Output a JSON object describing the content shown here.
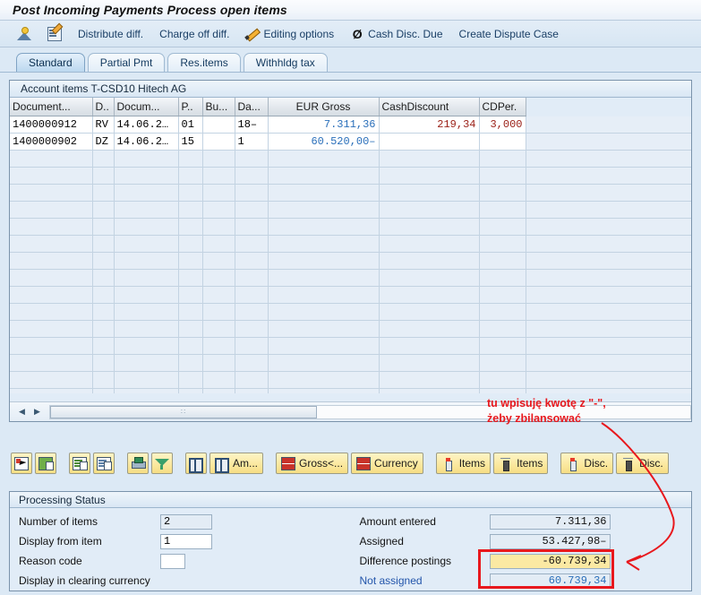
{
  "window": {
    "title": "Post Incoming Payments  Process open items"
  },
  "function_toolbar": {
    "items": [
      {
        "label": "",
        "icon": "distribute-person-icon",
        "interactable": true
      },
      {
        "label": "",
        "icon": "note-edit-icon",
        "interactable": true
      },
      {
        "label": "Distribute diff.",
        "icon": "",
        "interactable": true
      },
      {
        "label": "Charge off diff.",
        "icon": "",
        "interactable": true
      },
      {
        "label": "Editing options",
        "icon": "pencil-icon",
        "interactable": true
      },
      {
        "label": "Cash Disc. Due",
        "icon": "slashed-zero-icon",
        "interactable": true
      },
      {
        "label": "Create Dispute Case",
        "icon": "",
        "interactable": true
      }
    ]
  },
  "tabs": [
    {
      "label": "Standard",
      "active": true
    },
    {
      "label": "Partial Pmt",
      "active": false
    },
    {
      "label": "Res.items",
      "active": false
    },
    {
      "label": "Withhldg tax",
      "active": false
    }
  ],
  "grid": {
    "caption": "Account items T-CSD10 Hitech AG",
    "columns": [
      {
        "key": "document",
        "label": "Document...",
        "align": "left"
      },
      {
        "key": "doctype",
        "label": "D..",
        "align": "left"
      },
      {
        "key": "docdate",
        "label": "Docum...",
        "align": "left"
      },
      {
        "key": "p",
        "label": "P..",
        "align": "left"
      },
      {
        "key": "bu",
        "label": "Bu...",
        "align": "left"
      },
      {
        "key": "da",
        "label": "Da...",
        "align": "left"
      },
      {
        "key": "eurgross",
        "label": "EUR Gross",
        "align": "center"
      },
      {
        "key": "cashdiscount",
        "label": "CashDiscount",
        "align": "left"
      },
      {
        "key": "cdper",
        "label": "CDPer.",
        "align": "left"
      }
    ],
    "rows": [
      {
        "document": "1400000912",
        "doctype": "RV",
        "docdate": "14.06.2…",
        "p": "01",
        "bu": "",
        "da": "18–",
        "eurgross": "7.311,36",
        "eurgross_color": "blue",
        "cashdiscount": "219,34",
        "cashdiscount_color": "red",
        "cdper": "3,000",
        "cdper_color": "red"
      },
      {
        "document": "1400000902",
        "doctype": "DZ",
        "docdate": "14.06.2…",
        "p": "15",
        "bu": "",
        "da": "1",
        "eurgross": "60.520,00–",
        "eurgross_color": "blue",
        "cashdiscount": "",
        "cashdiscount_color": "black",
        "cdper": "",
        "cdper_color": "black"
      }
    ],
    "empty_row_count": 15,
    "scrollbar": {
      "left_arrow": "◀",
      "right_arrow": "▶",
      "thumb_grip": "∷"
    }
  },
  "button_toolbar": {
    "buttons": [
      {
        "label": "",
        "icon": "select-all-icon",
        "group": 0
      },
      {
        "label": "",
        "icon": "deselect-all-icon",
        "group": 0
      },
      {
        "label": "",
        "icon": "sort-ascending-icon",
        "group": 1
      },
      {
        "label": "",
        "icon": "sort-descending-icon",
        "group": 1
      },
      {
        "label": "",
        "icon": "print-icon",
        "group": 2
      },
      {
        "label": "",
        "icon": "filter-icon",
        "group": 2
      },
      {
        "label": "",
        "icon": "search-binoculars-icon",
        "group": 3
      },
      {
        "label": "Am...",
        "icon": "search-binoculars-icon",
        "group": 3
      },
      {
        "label": "Gross<...",
        "icon": "currency-icon",
        "group": 4
      },
      {
        "label": "Currency",
        "icon": "currency-icon",
        "group": 4
      },
      {
        "label": "Items",
        "icon": "lamp-on-icon",
        "group": 5
      },
      {
        "label": "Items",
        "icon": "lamp-off-icon",
        "group": 5
      },
      {
        "label": "Disc.",
        "icon": "lamp-on-icon",
        "group": 6
      },
      {
        "label": "Disc.",
        "icon": "lamp-off-icon",
        "group": 6
      }
    ]
  },
  "processing_status": {
    "caption": "Processing Status",
    "left_rows": [
      {
        "label": "Number of items",
        "value": "2",
        "readonly": true,
        "width": "w58"
      },
      {
        "label": "Display from item",
        "value": "1",
        "readonly": false,
        "width": "w58b"
      },
      {
        "label": "Reason code",
        "value": "",
        "readonly": false,
        "width": "w28"
      },
      {
        "label": "Display in clearing currency",
        "value": null,
        "readonly": false,
        "width": ""
      }
    ],
    "right_rows": [
      {
        "label": "Amount entered",
        "value": "7.311,36",
        "color": "black",
        "highlight": false,
        "is_link": false
      },
      {
        "label": "Assigned",
        "value": "53.427,98–",
        "color": "black",
        "highlight": false,
        "is_link": false
      },
      {
        "label": "Difference postings",
        "value": "-60.739,34",
        "color": "black",
        "highlight": true,
        "is_link": false
      },
      {
        "label": "Not assigned",
        "value": "60.739,34",
        "color": "blue",
        "highlight": false,
        "is_link": true
      }
    ]
  },
  "annotation": {
    "line1": "tu wpisuję kwotę z \"-\",",
    "line2": "żeby zbilansować",
    "color": "#e8181d"
  },
  "colors": {
    "accent_blue": "#2a6fba",
    "value_red": "#9b2118",
    "annotation_red": "#e8181d",
    "highlight_yellow": "#fbe9a3",
    "panel_bg": "#e1ecf7",
    "app_bg": "#dce9f5"
  }
}
